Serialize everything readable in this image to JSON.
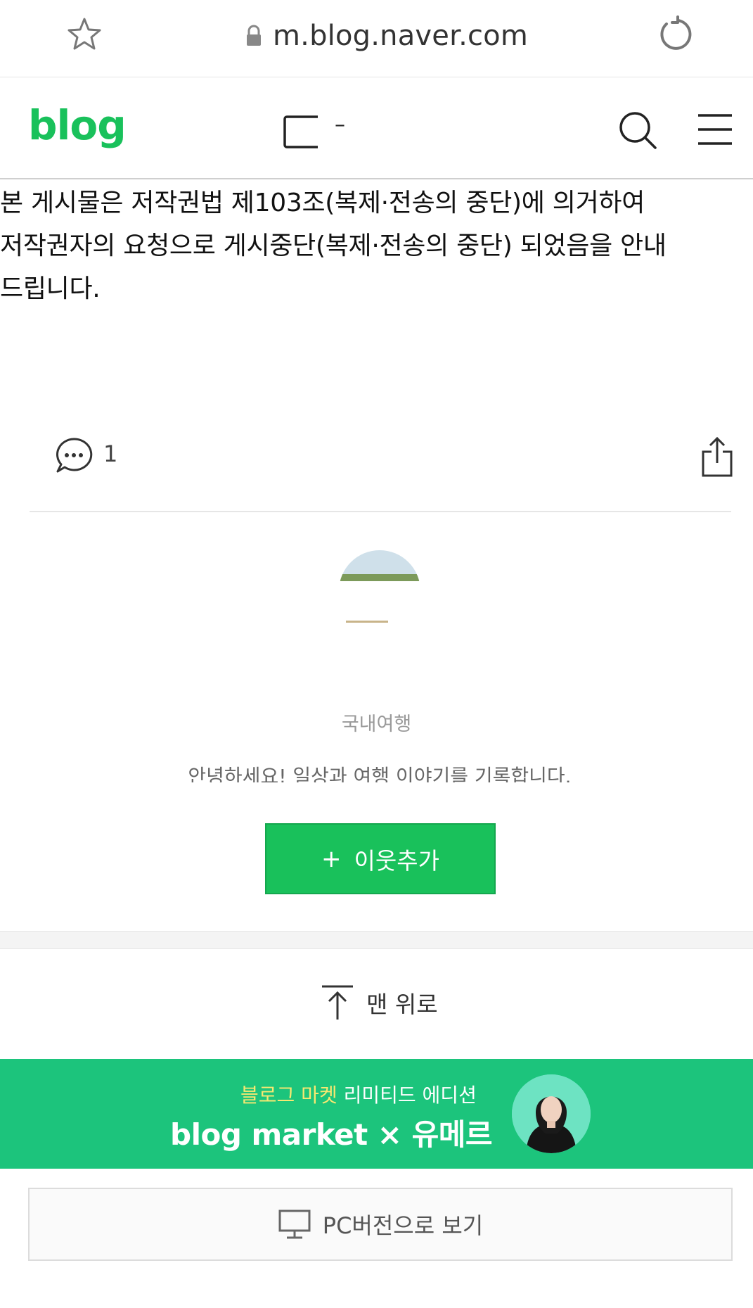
{
  "browser": {
    "url": "m.blog.naver.com",
    "icons": {
      "bookmark": "star-icon",
      "secure": "lock-icon",
      "reload": "reload-icon"
    }
  },
  "header": {
    "logo": "blog",
    "title_fragment": "–",
    "icons": {
      "search": "search-icon",
      "menu": "menu-icon",
      "page": "page-icon"
    }
  },
  "notice": {
    "text": "본 게시물은 저작권법 제103조(복제·전송의 중단)에 의거하여 저작권자의 요청으로 게시중단(복제·전송의 중단) 되었음을 안내 드립니다."
  },
  "actions": {
    "comment_count": "1",
    "icons": {
      "comment": "comment-icon",
      "share": "share-icon"
    }
  },
  "profile": {
    "name": "",
    "category": "국내여행",
    "intro": "안녕하세요! 일상과 여행 이야기를 기록합니다."
  },
  "follow": {
    "label": "이웃추가",
    "plus": "+"
  },
  "top": {
    "label": "맨 위로"
  },
  "banner": {
    "sub_highlight": "블로그 마켓",
    "sub_rest": " 리미티드 에디션",
    "main": "blog market × 유메르",
    "colors": {
      "background": "#1cc47c",
      "highlight": "#f7e871"
    }
  },
  "pc_version": {
    "label": "PC버전으로 보기"
  },
  "colors": {
    "brand_green": "#19c15b"
  }
}
